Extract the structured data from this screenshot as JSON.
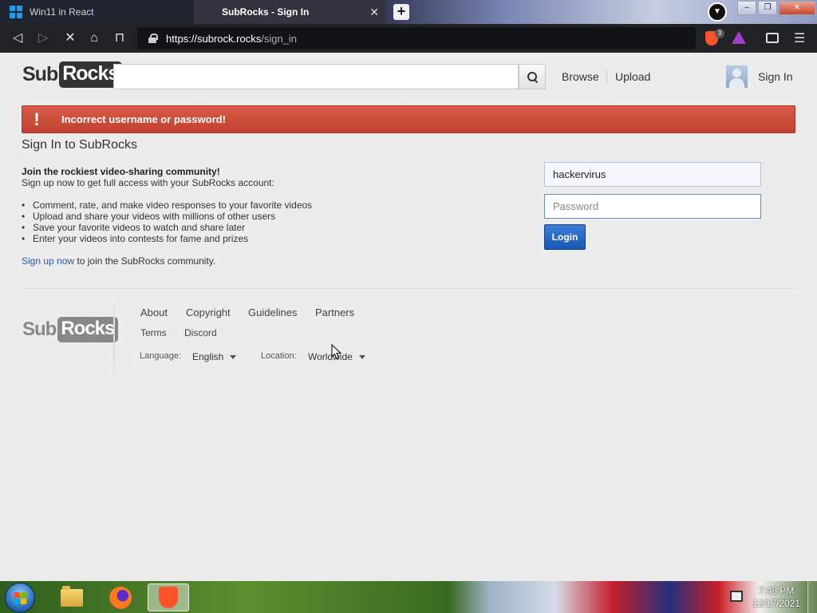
{
  "browser": {
    "tabs": [
      {
        "title": "Win11 in React"
      },
      {
        "title": "SubRocks - Sign In"
      }
    ],
    "url": {
      "host": "https://subrock.rocks",
      "path": "/sign_in"
    },
    "shield_count": "3"
  },
  "site": {
    "logo": {
      "sub": "Sub",
      "rocks": "Rocks"
    },
    "search_placeholder": "",
    "nav": {
      "browse": "Browse",
      "upload": "Upload",
      "sign_in": "Sign In"
    }
  },
  "alert": {
    "message": "Incorrect username or password!"
  },
  "signin": {
    "title": "Sign In to SubRocks",
    "lead_bold": "Join the rockiest video-sharing community!",
    "lead_text": "Sign up now to get full access with your SubRocks account:",
    "features": [
      "Comment, rate, and make video responses to your favorite videos",
      "Upload and share your videos with millions of other users",
      "Save your favorite videos to watch and share later",
      "Enter your videos into contests for fame and prizes"
    ],
    "signup_link": "Sign up now",
    "signup_rest": " to join the SubRocks community.",
    "username_value": "hackervirus",
    "password_placeholder": "Password",
    "login_label": "Login"
  },
  "footer": {
    "links": [
      "About",
      "Copyright",
      "Guidelines",
      "Partners"
    ],
    "small_links": [
      "Terms",
      "Discord"
    ],
    "language_label": "Language:",
    "language_value": "English",
    "location_label": "Location:",
    "location_value": "Worldwide"
  },
  "taskbar": {
    "time": "7:48 PM",
    "date": "12/17/2021"
  }
}
